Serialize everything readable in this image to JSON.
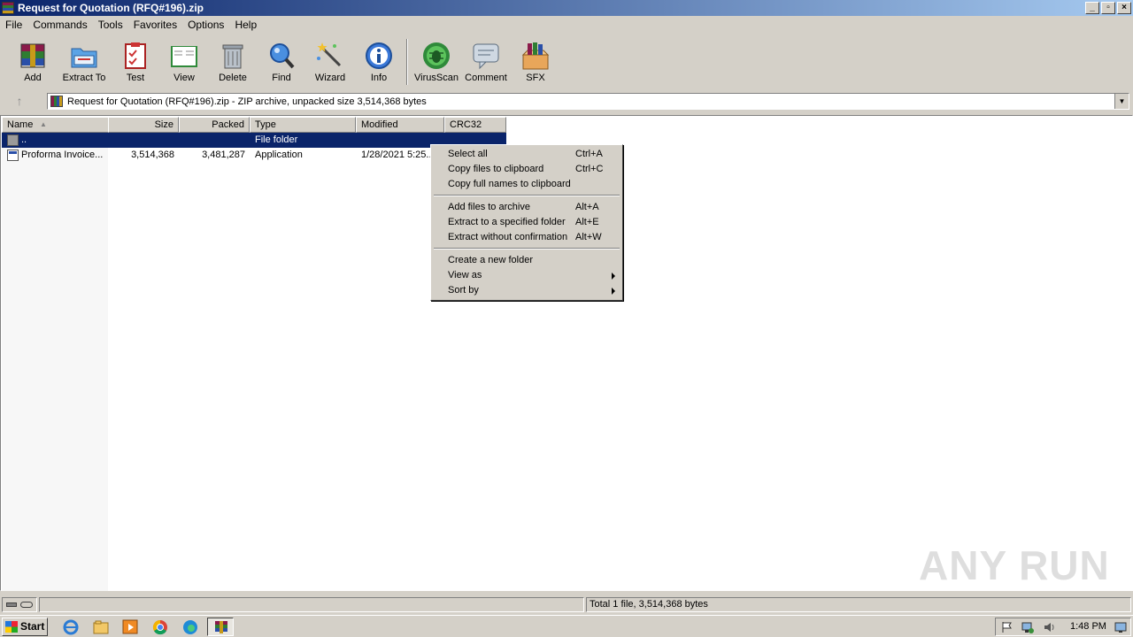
{
  "window": {
    "title": "Request for Quotation (RFQ#196).zip",
    "controls": [
      "_",
      "▫",
      "×"
    ]
  },
  "menubar": [
    "File",
    "Commands",
    "Tools",
    "Favorites",
    "Options",
    "Help"
  ],
  "toolbar": {
    "add": "Add",
    "extract_to": "Extract To",
    "test": "Test",
    "view": "View",
    "delete": "Delete",
    "find": "Find",
    "wizard": "Wizard",
    "info": "Info",
    "virusscan": "VirusScan",
    "comment": "Comment",
    "sfx": "SFX"
  },
  "address": {
    "text": "Request for Quotation (RFQ#196).zip - ZIP archive, unpacked size 3,514,368 bytes"
  },
  "columns": {
    "name": "Name",
    "size": "Size",
    "packed": "Packed",
    "type": "Type",
    "modified": "Modified",
    "crc32": "CRC32"
  },
  "rows": [
    {
      "name": "..",
      "size": "",
      "packed": "",
      "type": "File folder",
      "modified": "",
      "crc32": ""
    },
    {
      "name": "Proforma Invoice...",
      "size": "3,514,368",
      "packed": "3,481,287",
      "type": "Application",
      "modified": "1/28/2021 5:25...",
      "crc32": ""
    }
  ],
  "context_menu": {
    "select_all": {
      "label": "Select all",
      "shortcut": "Ctrl+A"
    },
    "copy_files": {
      "label": "Copy files to clipboard",
      "shortcut": "Ctrl+C"
    },
    "copy_names": {
      "label": "Copy full names to clipboard",
      "shortcut": ""
    },
    "add_files": {
      "label": "Add files to archive",
      "shortcut": "Alt+A"
    },
    "extract_folder": {
      "label": "Extract to a specified folder",
      "shortcut": "Alt+E"
    },
    "extract_noconfirm": {
      "label": "Extract without confirmation",
      "shortcut": "Alt+W"
    },
    "new_folder": {
      "label": "Create a new folder"
    },
    "view_as": {
      "label": "View as"
    },
    "sort_by": {
      "label": "Sort by"
    }
  },
  "status": {
    "right": "Total 1 file, 3,514,368 bytes"
  },
  "watermark": "ANY RUN",
  "taskbar": {
    "start": "Start",
    "clock": "1:48 PM"
  }
}
